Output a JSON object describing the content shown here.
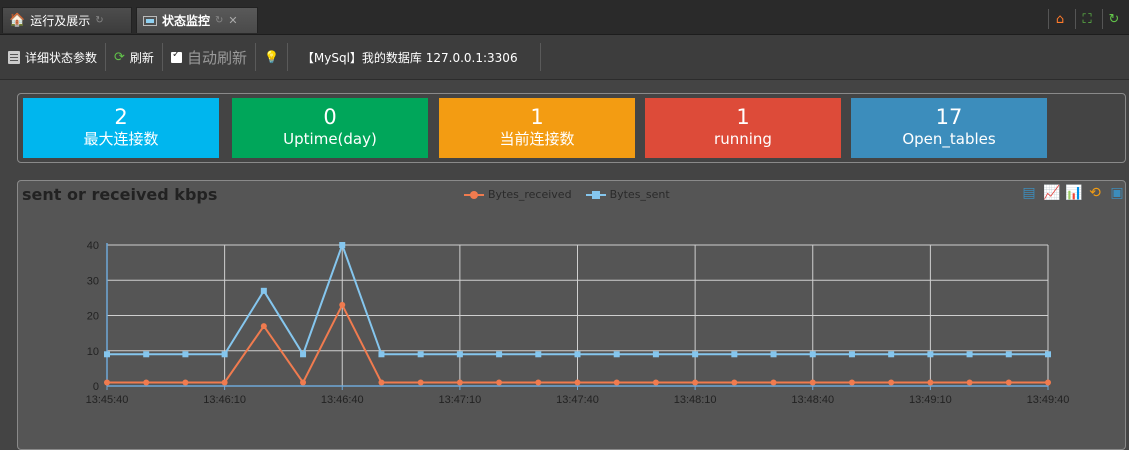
{
  "tabs": [
    {
      "label": "运行及展示",
      "icon": "home-icon"
    },
    {
      "label": "状态监控",
      "icon": "monitor-icon"
    }
  ],
  "top_right_icons": [
    "home-icon",
    "fullscreen-icon",
    "refresh-icon"
  ],
  "toolbar": {
    "detail_label": "详细状态参数",
    "refresh_label": "刷新",
    "auto_refresh_label": "自动刷新",
    "auto_refresh_checked": true,
    "connection_label": "【MySql】我的数据库 127.0.0.1:3306"
  },
  "stats": [
    {
      "value": "2",
      "label": "最大连接数",
      "color": "#00b6ee"
    },
    {
      "value": "0",
      "label": "Uptime(day)",
      "color": "#00a65a"
    },
    {
      "value": "1",
      "label": "当前连接数",
      "color": "#f39c12"
    },
    {
      "value": "1",
      "label": "running",
      "color": "#dd4b39"
    },
    {
      "value": "17",
      "label": "Open_tables",
      "color": "#3c8dbc"
    }
  ],
  "chart_tools": [
    "data-view-icon",
    "line-chart-icon",
    "bar-chart-icon",
    "restore-icon",
    "save-icon"
  ],
  "chart_data": {
    "type": "line",
    "title": "sent or received kbps",
    "x": [
      "13:45:40",
      "13:45:50",
      "13:46:00",
      "13:46:10",
      "13:46:20",
      "13:46:30",
      "13:46:40",
      "13:46:50",
      "13:47:00",
      "13:47:10",
      "13:47:20",
      "13:47:30",
      "13:47:40",
      "13:47:50",
      "13:48:00",
      "13:48:10",
      "13:48:20",
      "13:48:30",
      "13:48:40",
      "13:48:50",
      "13:49:00",
      "13:49:10",
      "13:49:20",
      "13:49:30",
      "13:49:40"
    ],
    "x_tick_labels": [
      "13:45:40",
      "13:46:10",
      "13:46:40",
      "13:47:10",
      "13:47:40",
      "13:48:10",
      "13:48:40",
      "13:49:10",
      "13:49:40"
    ],
    "y_ticks": [
      0,
      10,
      20,
      30,
      40
    ],
    "ylim": [
      0,
      40
    ],
    "legend_position": "top-center",
    "grid": true,
    "series": [
      {
        "name": "Bytes_received",
        "color": "#f07b4f",
        "marker": "circle",
        "values": [
          1,
          1,
          1,
          1,
          17,
          1,
          23,
          1,
          1,
          1,
          1,
          1,
          1,
          1,
          1,
          1,
          1,
          1,
          1,
          1,
          1,
          1,
          1,
          1,
          1
        ]
      },
      {
        "name": "Bytes_sent",
        "color": "#85c6ee",
        "marker": "square",
        "values": [
          9,
          9,
          9,
          9,
          27,
          9,
          40,
          9,
          9,
          9,
          9,
          9,
          9,
          9,
          9,
          9,
          9,
          9,
          9,
          9,
          9,
          9,
          9,
          9,
          9
        ]
      }
    ]
  }
}
